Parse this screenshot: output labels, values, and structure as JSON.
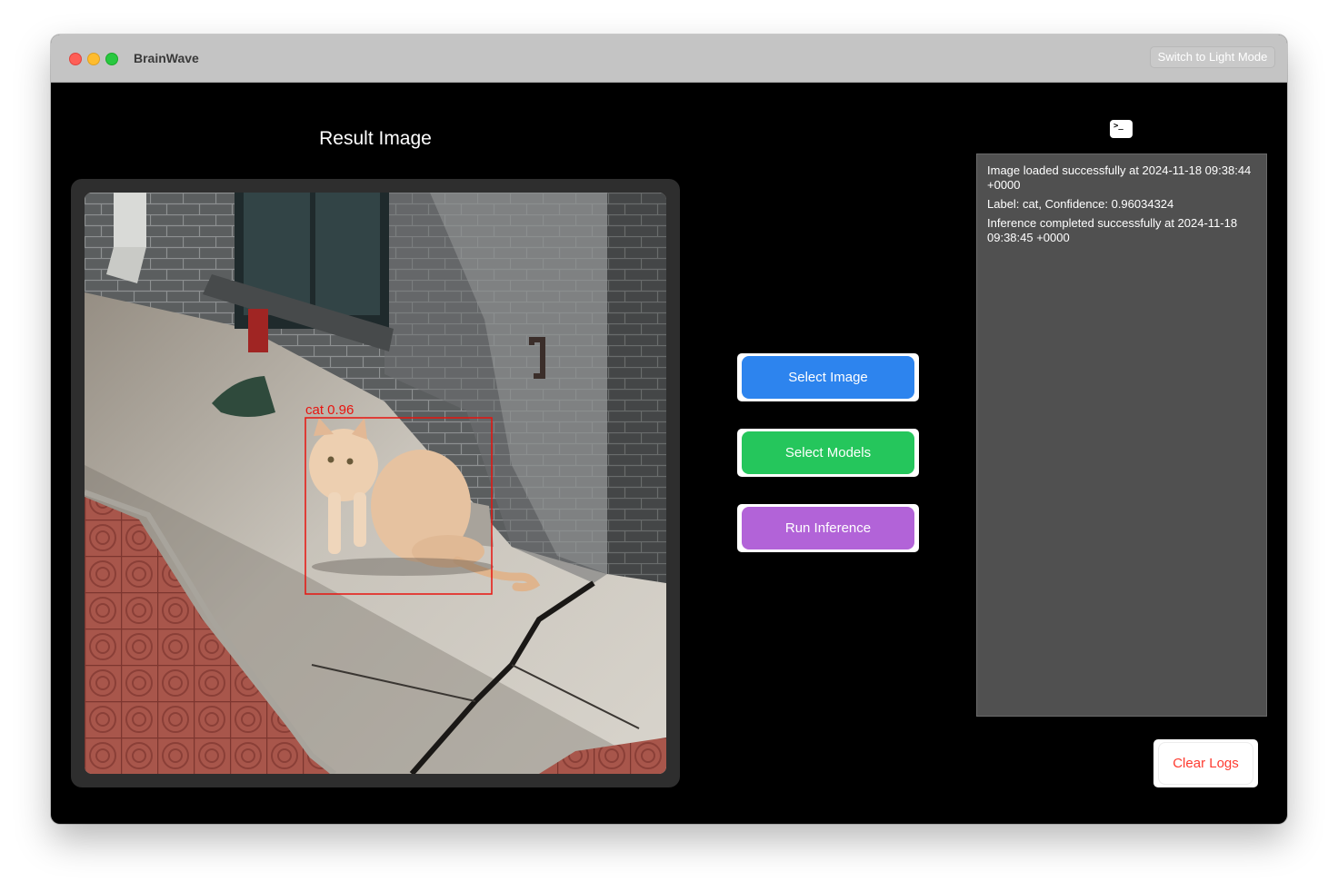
{
  "window": {
    "title": "BrainWave",
    "theme_toggle_label": "Switch to Light Mode"
  },
  "result": {
    "title": "Result Image",
    "detection_label": "cat 0.96"
  },
  "actions": {
    "select_image": "Select Image",
    "select_models": "Select Models",
    "run_inference": "Run Inference"
  },
  "logs": {
    "icon_glyph": ">_",
    "lines": [
      "Image loaded successfully at 2024-11-18 09:38:44 +0000",
      "Label: cat, Confidence: 0.96034324",
      "Inference completed successfully at 2024-11-18 09:38:45 +0000"
    ],
    "clear_label": "Clear Logs"
  },
  "colors": {
    "select_image": "#2d84ee",
    "select_models": "#25c65c",
    "run_inference": "#b263d8",
    "clear_logs_text": "#fe3b30",
    "detection_box": "#e8140f"
  }
}
